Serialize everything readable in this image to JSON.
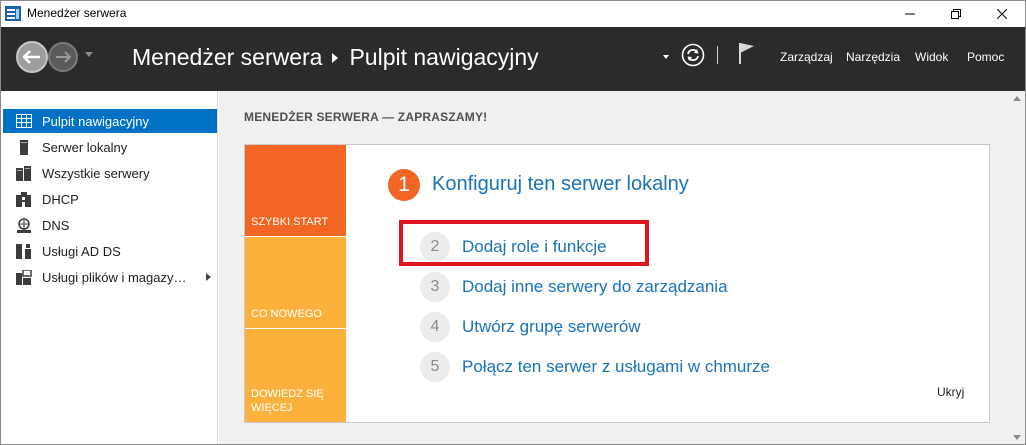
{
  "window": {
    "title": "Menedżer serwera",
    "icons": {
      "app": "server-manager-icon",
      "minimize": "minimize-icon",
      "maximize": "restore-icon",
      "close": "close-icon"
    }
  },
  "header": {
    "breadcrumb": [
      "Menedżer serwera",
      "Pulpit nawigacyjny"
    ],
    "menu": [
      "Zarządzaj",
      "Narzędzia",
      "Widok",
      "Pomoc"
    ],
    "icons": [
      "back-arrow-icon",
      "forward-arrow-icon",
      "refresh-icon",
      "flag-icon"
    ]
  },
  "sidebar": {
    "items": [
      {
        "label": "Pulpit nawigacyjny",
        "icon": "dashboard-icon",
        "selected": true
      },
      {
        "label": "Serwer lokalny",
        "icon": "server-icon"
      },
      {
        "label": "Wszystkie serwery",
        "icon": "servers-icon"
      },
      {
        "label": "DHCP",
        "icon": "dhcp-icon"
      },
      {
        "label": "DNS",
        "icon": "dns-icon"
      },
      {
        "label": "Usługi AD DS",
        "icon": "ad-ds-icon"
      },
      {
        "label": "Usługi plików i magazy…",
        "icon": "file-storage-icon",
        "expandable": true
      }
    ]
  },
  "main": {
    "welcome": "MENEDŻER SERWERA — ZAPRASZAMY!",
    "tiles": [
      "SZYBKI START",
      "CO NOWEGO",
      "DOWIEDZ SIĘ WIĘCEJ"
    ],
    "step1": {
      "number": "1",
      "text": "Konfiguruj ten serwer lokalny"
    },
    "steps": [
      {
        "number": "2",
        "text": "Dodaj role i funkcje"
      },
      {
        "number": "3",
        "text": "Dodaj inne serwery do zarządzania"
      },
      {
        "number": "4",
        "text": "Utwórz grupę serwerów"
      },
      {
        "number": "5",
        "text": "Połącz ten serwer z usługami w chmurze"
      }
    ],
    "hide": "Ukryj"
  },
  "colors": {
    "header_bg": "#2b2b2b",
    "selected": "#0072c6",
    "tile_orange": "#f26522",
    "tile_yellow": "#fcb13d",
    "link": "#1a73b8",
    "highlight": "#e0141e"
  }
}
